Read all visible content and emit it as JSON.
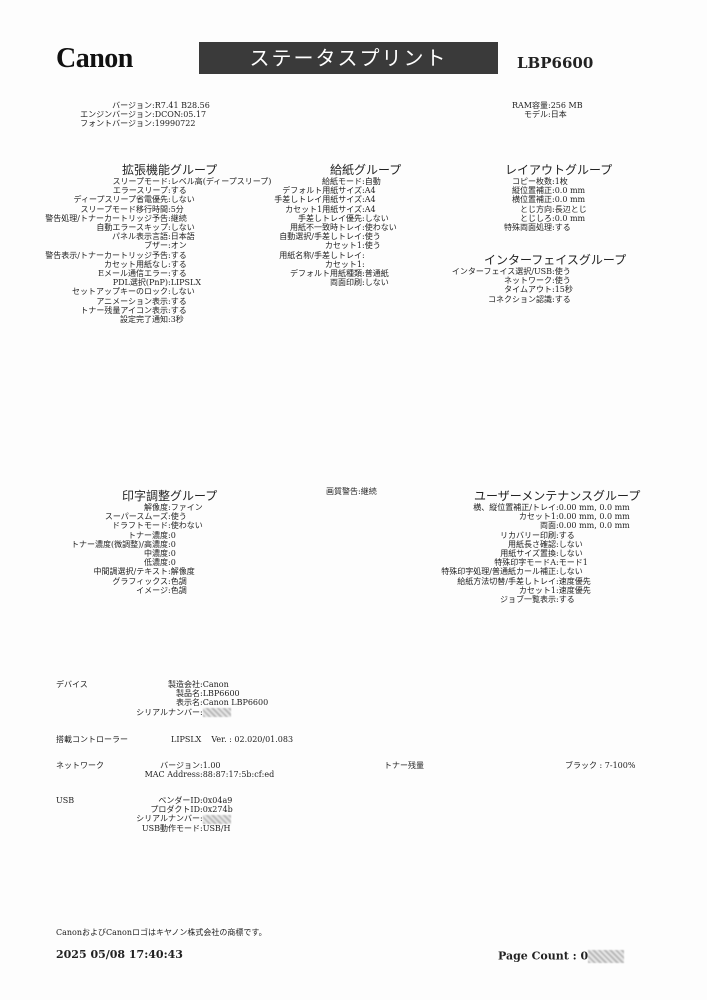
{
  "header": {
    "logo": "Canon",
    "title": "ステータスプリント",
    "model": "LBP6600"
  },
  "info_left": [
    {
      "k": "バージョン",
      "v": "R7.41  B28.56"
    },
    {
      "k": "エンジンバージョン",
      "v": "DCON:05.17"
    },
    {
      "k": "フォントバージョン",
      "v": "19990722"
    }
  ],
  "info_right": [
    {
      "k": "RAM容量",
      "v": "256 MB"
    },
    {
      "k": "モデル",
      "v": "日本"
    }
  ],
  "group_extended": {
    "title": "拡張機能グループ",
    "rows": [
      {
        "k": "スリープモード",
        "v": "レベル高(ディープスリープ)"
      },
      {
        "k": "エラースリープ",
        "v": "する"
      },
      {
        "k": "ディープスリープ省電優先",
        "v": "しない"
      },
      {
        "k": "スリープモード移行時間",
        "v": "5分"
      },
      {
        "k": "警告処理/トナーカートリッジ予告",
        "v": "継続"
      },
      {
        "k": "自動エラースキップ",
        "v": "しない"
      },
      {
        "k": "パネル表示言語",
        "v": "日本語"
      },
      {
        "k": "ブザー",
        "v": "オン"
      },
      {
        "k": "警告表示/トナーカートリッジ予告",
        "v": "する"
      },
      {
        "k": "カセット用紙なし",
        "v": "する"
      },
      {
        "k": "Eメール通信エラー",
        "v": "する"
      },
      {
        "k": "PDL選択(PnP)",
        "v": "LIPSLX"
      },
      {
        "k": "セットアップキーのロック",
        "v": "しない"
      },
      {
        "k": "アニメーション表示",
        "v": "する"
      },
      {
        "k": "トナー残量アイコン表示",
        "v": "する"
      },
      {
        "k": "設定完了通知",
        "v": "3秒"
      }
    ]
  },
  "group_paper": {
    "title": "給紙グループ",
    "rows": [
      {
        "k": "給紙モード",
        "v": "自動"
      },
      {
        "k": "デフォルト用紙サイズ",
        "v": "A4"
      },
      {
        "k": "手差しトレイ用紙サイズ",
        "v": "A4"
      },
      {
        "k": "カセット1用紙サイズ",
        "v": "A4"
      },
      {
        "k": "手差しトレイ優先",
        "v": "しない"
      },
      {
        "k": "用紙不一致時トレイ",
        "v": "使わない"
      },
      {
        "k": "自動選択/手差しトレイ",
        "v": "使う"
      },
      {
        "k": "カセット1",
        "v": "使う"
      },
      {
        "k": "用紙名称/手差しトレイ",
        "v": ""
      },
      {
        "k": "カセット1",
        "v": ""
      },
      {
        "k": "デフォルト用紙種類",
        "v": "普通紙"
      },
      {
        "k": "両面印刷",
        "v": "しない"
      }
    ]
  },
  "group_layout": {
    "title": "レイアウトグループ",
    "rows": [
      {
        "k": "コピー枚数",
        "v": "1枚"
      },
      {
        "k": "縦位置補正",
        "v": "0.0 mm"
      },
      {
        "k": "横位置補正",
        "v": "0.0 mm"
      },
      {
        "k": "とじ方向",
        "v": "長辺とじ"
      },
      {
        "k": "とじしろ",
        "v": "0.0 mm"
      },
      {
        "k": "特殊両面処理",
        "v": "する"
      }
    ]
  },
  "group_interface": {
    "title": "インターフェイスグループ",
    "rows": [
      {
        "k": "インターフェイス選択/USB",
        "v": "使う"
      },
      {
        "k": "ネットワーク",
        "v": "使う"
      },
      {
        "k": "タイムアウト",
        "v": "15秒"
      },
      {
        "k": "コネクション認識",
        "v": "する"
      }
    ]
  },
  "group_print": {
    "title": "印字調整グループ",
    "rows": [
      {
        "k": "解像度",
        "v": "ファイン"
      },
      {
        "k": "スーパースムーズ",
        "v": "使う"
      },
      {
        "k": "ドラフトモード",
        "v": "使わない"
      },
      {
        "k": "トナー濃度",
        "v": "0"
      },
      {
        "k": "トナー濃度(微調整)/高濃度",
        "v": "0"
      },
      {
        "k": "中濃度",
        "v": "0"
      },
      {
        "k": "低濃度",
        "v": "0"
      },
      {
        "k": "中間調選択/テキスト",
        "v": "解像度"
      },
      {
        "k": "グラフィックス",
        "v": "色調"
      },
      {
        "k": "イメージ",
        "v": "色調"
      }
    ]
  },
  "quality_warning": {
    "k": "画質警告",
    "v": "継続"
  },
  "group_maintenance": {
    "title": "ユーザーメンテナンスグループ",
    "rows": [
      {
        "k": "横、縦位置補正/トレイ",
        "v": "0.00 mm, 0.0 mm"
      },
      {
        "k": "カセット1",
        "v": "0.00 mm, 0.0 mm"
      },
      {
        "k": "両面",
        "v": "0.00 mm, 0.0 mm"
      },
      {
        "k": "リカバリー印刷",
        "v": "する"
      },
      {
        "k": "用紙長さ確認",
        "v": "しない"
      },
      {
        "k": "用紙サイズ置換",
        "v": "しない"
      },
      {
        "k": "特殊印字モードA",
        "v": "モード1"
      },
      {
        "k": "特殊印字処理/普通紙カール補正",
        "v": "しない"
      },
      {
        "k": "給紙方法切替/手差しトレイ",
        "v": "速度優先"
      },
      {
        "k": "カセット1",
        "v": "速度優先"
      },
      {
        "k": "ジョブ一覧表示",
        "v": "する"
      }
    ]
  },
  "device": {
    "label": "デバイス",
    "rows": [
      {
        "k": "製造会社",
        "v": "Canon"
      },
      {
        "k": "製品名",
        "v": "LBP6600"
      },
      {
        "k": "表示名",
        "v": "Canon LBP6600"
      },
      {
        "k": "シリアルナンバー",
        "v": ""
      }
    ]
  },
  "controller": {
    "label": "搭載コントローラー",
    "name": "LIPSLX",
    "k": "Ver.",
    "v": "02.020/01.083"
  },
  "network": {
    "label": "ネットワーク",
    "rows": [
      {
        "k": "バージョン",
        "v": "1.00"
      },
      {
        "k": "MAC Address",
        "v": "88:87:17:5b:cf:ed"
      }
    ]
  },
  "toner": {
    "label": "トナー残量",
    "k": "ブラック",
    "v": "7-100%"
  },
  "usb": {
    "label": "USB",
    "rows": [
      {
        "k": "ベンダーID",
        "v": "0x04a9"
      },
      {
        "k": "プロダクトID",
        "v": "0x274b"
      },
      {
        "k": "シリアルナンバー",
        "v": ""
      },
      {
        "k": "USB動作モード",
        "v": "USB/H"
      }
    ]
  },
  "footer": {
    "trademark": "CanonおよびCanonロゴはキヤノン株式会社の商標です。",
    "datetime": "2025 05/08 17:40:43",
    "page_count_label": "Page Count : ",
    "page_count_prefix": "0"
  }
}
